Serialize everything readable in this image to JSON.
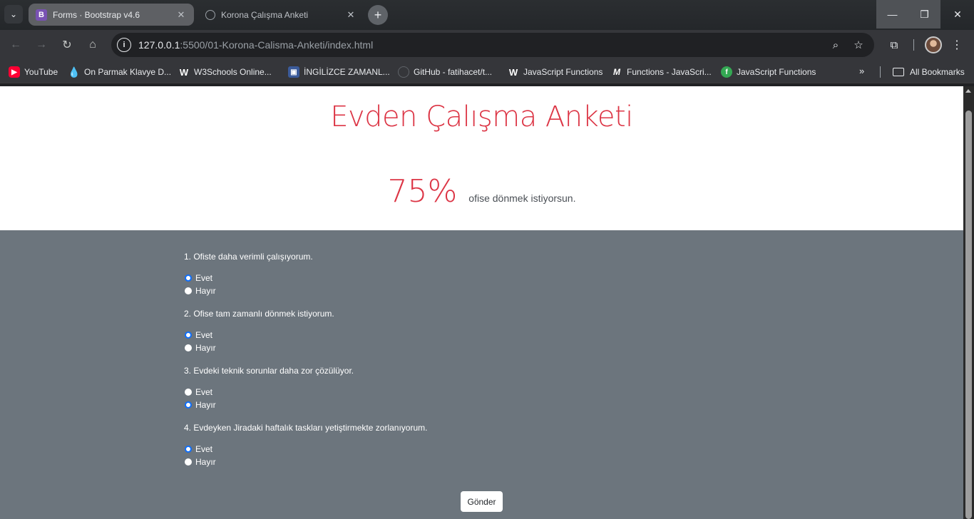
{
  "browser": {
    "tabs": [
      {
        "title": "Forms · Bootstrap v4.6",
        "favicon": "bootstrap-icon",
        "active": true
      },
      {
        "title": "Korona Çalışma Anketi",
        "favicon": "globe-icon",
        "active": false
      }
    ],
    "address": {
      "host": "127.0.0.1",
      "rest": ":5500/01-Korona-Calisma-Anketi/index.html"
    },
    "bookmarks": [
      {
        "label": "YouTube",
        "icon": "youtube-icon"
      },
      {
        "label": "On Parmak Klavye D...",
        "icon": "drop-icon"
      },
      {
        "label": "W3Schools Online...",
        "icon": "w3schools-icon"
      },
      {
        "label": "İNGİLİZCE ZAMANL...",
        "icon": "ingilizce-icon"
      },
      {
        "label": "GitHub - fatihacet/t...",
        "icon": "github-icon"
      },
      {
        "label": "JavaScript Functions",
        "icon": "w3schools-icon"
      },
      {
        "label": "Functions - JavaScri...",
        "icon": "mdn-icon"
      },
      {
        "label": "JavaScript Functions",
        "icon": "js-icon"
      }
    ],
    "all_bookmarks_label": "All Bookmarks"
  },
  "page": {
    "title": "Evden Çalışma Anketi",
    "result_percent": "75%",
    "result_text": "ofise dönmek istiyorsun.",
    "questions": [
      {
        "text": "1. Ofiste daha verimli çalışıyorum.",
        "options": [
          "Evet",
          "Hayır"
        ],
        "selected": "Evet"
      },
      {
        "text": "2. Ofise tam zamanlı dönmek istiyorum.",
        "options": [
          "Evet",
          "Hayır"
        ],
        "selected": "Evet"
      },
      {
        "text": "3. Evdeki teknik sorunlar daha zor çözülüyor.",
        "options": [
          "Evet",
          "Hayır"
        ],
        "selected": "Hayır"
      },
      {
        "text": "4. Evdeyken Jiradaki haftalık taskları yetiştirmekte zorlanıyorum.",
        "options": [
          "Evet",
          "Hayır"
        ],
        "selected": "Evet"
      }
    ],
    "submit_label": "Gönder"
  },
  "colors": {
    "accent": "#dc3545",
    "survey_bg": "#6c757d",
    "radio_selected": "#0d6efd"
  }
}
